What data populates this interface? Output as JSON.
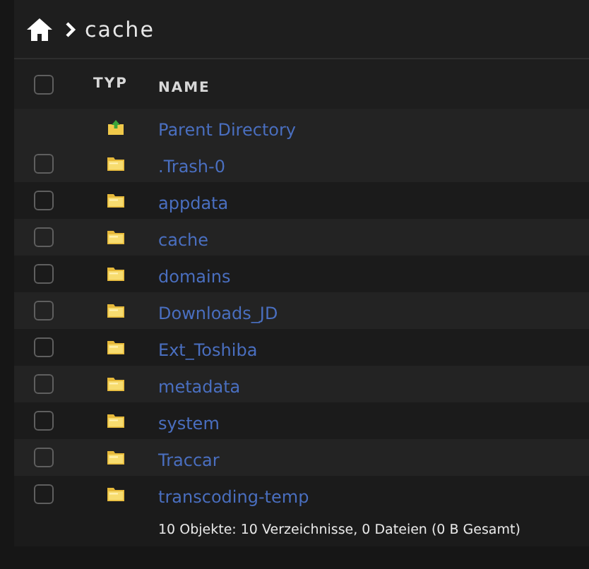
{
  "breadcrumb": {
    "path": "cache"
  },
  "table": {
    "columns": [
      "TYP",
      "NAME"
    ],
    "select_all": {
      "checked": false
    },
    "rows": [
      {
        "kind": "parent",
        "name": "Parent Directory"
      },
      {
        "kind": "folder",
        "name": ".Trash-0",
        "checked": false
      },
      {
        "kind": "folder",
        "name": "appdata",
        "checked": false
      },
      {
        "kind": "folder",
        "name": "cache",
        "checked": false
      },
      {
        "kind": "folder",
        "name": "domains",
        "checked": false
      },
      {
        "kind": "folder",
        "name": "Downloads_JD",
        "checked": false
      },
      {
        "kind": "folder",
        "name": "Ext_Toshiba",
        "checked": false
      },
      {
        "kind": "folder",
        "name": "metadata",
        "checked": false
      },
      {
        "kind": "folder",
        "name": "system",
        "checked": false
      },
      {
        "kind": "folder",
        "name": "Traccar",
        "checked": false
      },
      {
        "kind": "folder",
        "name": "transcoding-temp",
        "checked": false
      }
    ]
  },
  "summary": "10 Objekte: 10 Verzeichnisse, 0 Dateien (0 B Gesamt)"
}
